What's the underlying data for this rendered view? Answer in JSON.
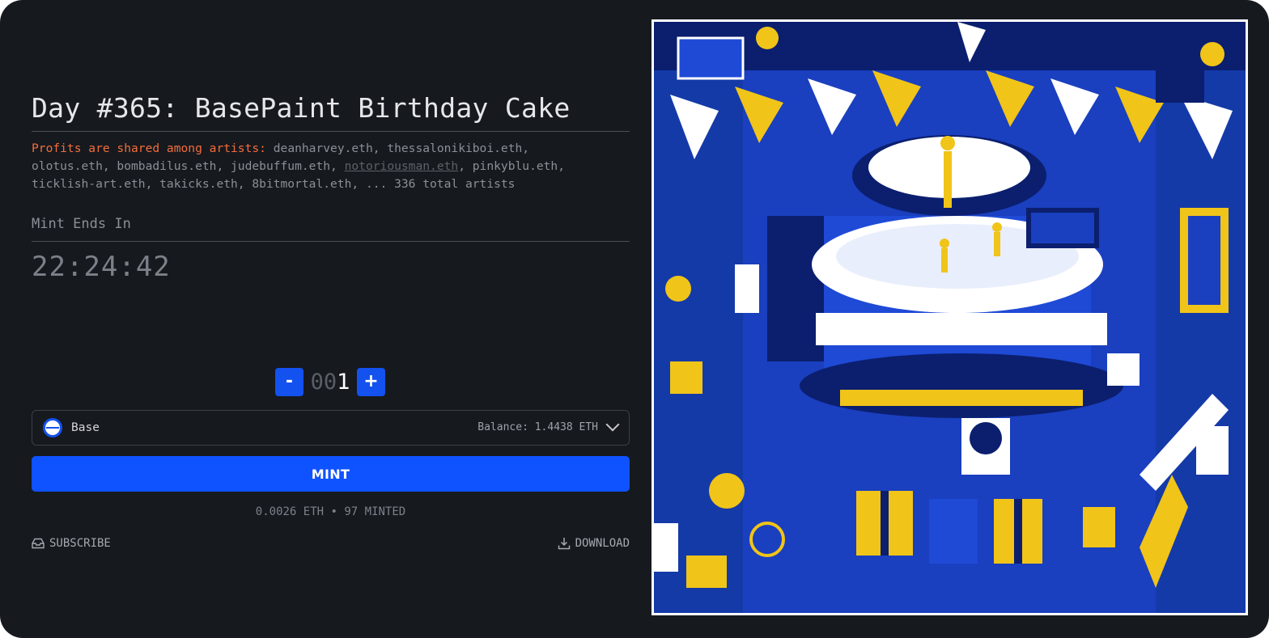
{
  "title": "Day #365: BasePaint Birthday Cake",
  "artists": {
    "lead": "Profits are shared among artists:",
    "before": "deanharvey.eth, thessalonikiboi.eth,",
    "line2a": "olotus.eth, bombadilus.eth, judebuffum.eth,",
    "underlined": "notoriousman.eth",
    "line2b": ", pinkyblu.eth,",
    "line3": "ticklish-art.eth, takicks.eth, 8bitmortal.eth, ... 336 total artists"
  },
  "mint_ends": {
    "label": "Mint Ends In",
    "time": "22:24:42"
  },
  "quantity": {
    "minus": "-",
    "plus": "+",
    "padding": "00",
    "value": "1"
  },
  "network": {
    "name": "Base",
    "balance": "Balance: 1.4438 ETH",
    "icon": "base-logo-icon"
  },
  "mint": {
    "button": "MINT",
    "info": "0.0026 ETH • 97 MINTED"
  },
  "links": {
    "subscribe": "SUBSCRIBE",
    "download": "DOWNLOAD"
  },
  "colors": {
    "background": "#16191e",
    "accent": "#0f52ff",
    "lead_text": "#f36d3c",
    "art_blue": "#1a3fbf",
    "art_yellow": "#f0c419",
    "art_navy": "#0b1f6e"
  }
}
